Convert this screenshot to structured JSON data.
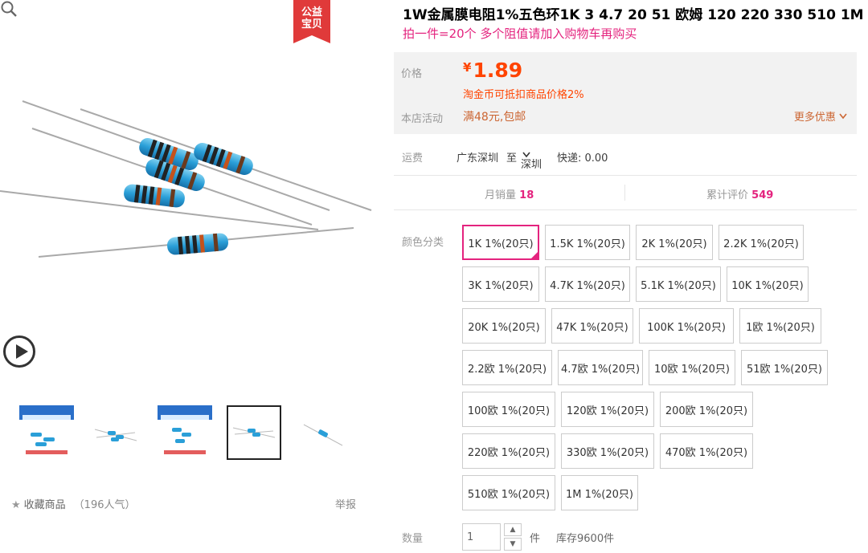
{
  "badge": {
    "line1": "公益",
    "line2": "宝贝"
  },
  "icons": {
    "play": "play-icon",
    "zoom": "zoom-icon",
    "star": "star-icon",
    "dropdown": "chevron-down-icon"
  },
  "colors": {
    "accent": "#e4237e",
    "price": "#ff4400",
    "promo": "#cc6633"
  },
  "gallery": {
    "thumb_count": 5,
    "active_thumb": 3
  },
  "favorite": {
    "label": "收藏商品",
    "popularity": "（196人气）"
  },
  "report_label": "举报",
  "product": {
    "title": "1W金属膜电阻1%五色环1K 3 4.7 20 51 欧姆 120 220 330 510 1M",
    "subtitle": "拍一件=20个 多个阻值请加入购物车再购买"
  },
  "price_box": {
    "price_label": "价格",
    "currency": "¥",
    "price": "1.89",
    "coin_note": "淘金币可抵扣商品价格2%",
    "promo_label": "本店活动",
    "promo_text": "满48元,包邮",
    "more_label": "更多优惠"
  },
  "shipping": {
    "label": "运费",
    "from": "广东深圳",
    "to_word": "至",
    "to": "深圳",
    "express": "快递: 0.00"
  },
  "stats": {
    "monthly_label": "月销量",
    "monthly_value": "18",
    "reviews_label": "累计评价",
    "reviews_value": "549"
  },
  "sku": {
    "label": "颜色分类",
    "selected_index": 0,
    "options": [
      "1K 1%(20只)",
      "1.5K 1%(20只)",
      "2K 1%(20只)",
      "2.2K 1%(20只)",
      "3K 1%(20只)",
      "4.7K 1%(20只)",
      "5.1K 1%(20只)",
      "10K 1%(20只)",
      "20K 1%(20只)",
      "47K 1%(20只)",
      "100K 1%(20只)",
      "1欧 1%(20只)",
      "2.2欧 1%(20只)",
      "4.7欧 1%(20只)",
      "10欧 1%(20只)",
      "51欧 1%(20只)",
      "100欧 1%(20只)",
      "120欧 1%(20只)",
      "200欧 1%(20只)",
      "220欧 1%(20只)",
      "330欧 1%(20只)",
      "470欧 1%(20只)",
      "510欧 1%(20只)",
      "1M 1%(20只)"
    ]
  },
  "quantity": {
    "label": "数量",
    "value": "1",
    "unit": "件",
    "stock": "库存9600件"
  }
}
